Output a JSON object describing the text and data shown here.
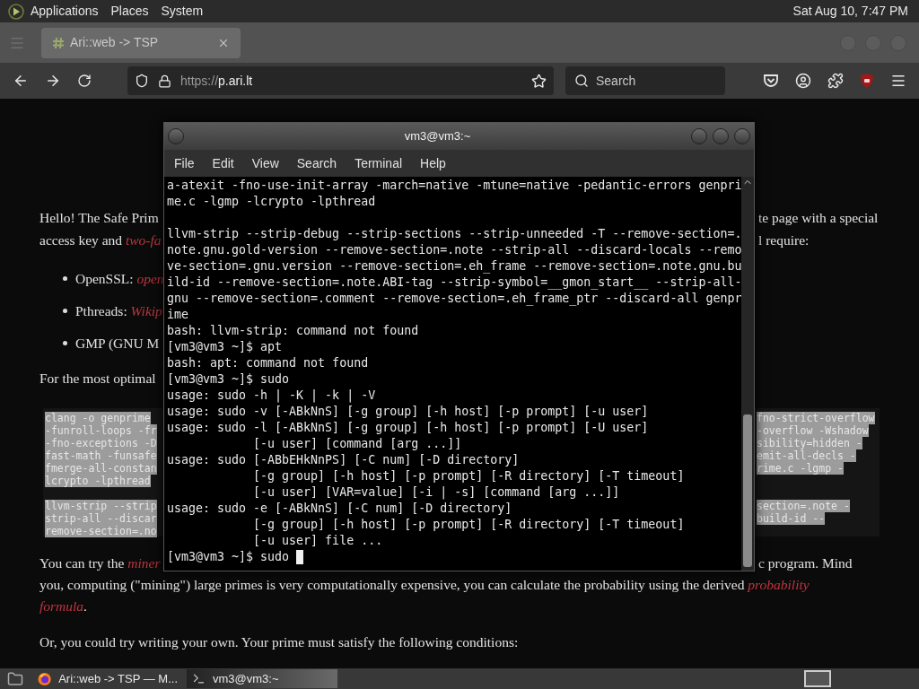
{
  "top_panel": {
    "menus": [
      "Applications",
      "Places",
      "System"
    ],
    "clock": "Sat Aug 10, 7:47 PM"
  },
  "browser": {
    "tabs": [
      {
        "title": "Ari::web -> TSP",
        "selected": true
      }
    ],
    "url": {
      "scheme": "https://",
      "host": "p.ari.lt"
    },
    "search": {
      "placeholder": "Search"
    }
  },
  "page": {
    "intro": [
      {
        "left": "Hello! The Safe Prim",
        "right": "te page with a special"
      },
      {
        "left": "access key and ",
        "link": "two-fa",
        "right": "l require:"
      }
    ],
    "bullets": [
      {
        "left": "OpenSSL: ",
        "link": "open"
      },
      {
        "left": "Pthreads: ",
        "link": "Wikip"
      },
      {
        "left": "GMP (GNU M"
      }
    ],
    "optimal": {
      "left": "For the most optimal"
    },
    "code": {
      "groups": [
        {
          "left": [
            "clang -o genprime",
            "-funroll-loops -fr",
            "-fno-exceptions -D",
            "fast-math -funsafe",
            "fmerge-all-constan",
            "lcrypto -lpthread"
          ],
          "right": [
            "fno-strict-overflow",
            "-overflow -Wshadow",
            "sibility=hidden -",
            "emit-all-decls -",
            "rime.c -lgmp -"
          ]
        },
        {
          "left": [
            "llvm-strip --strip",
            "strip-all --discar",
            "remove-section=.no"
          ],
          "right": [
            "section=.note -",
            "build-id --"
          ]
        }
      ]
    },
    "mining": [
      {
        "kind": "split",
        "left": "You can try the ",
        "link": "miner",
        "right": "c program. Mind"
      },
      {
        "kind": "full",
        "text": "you, computing (\"mining\") large primes is very computationally expensive, you can calculate the probability using the derived ",
        "link": "probability"
      },
      {
        "kind": "full",
        "link": "formula",
        "after": "."
      }
    ],
    "outro": "Or, you could try writing your own. Your prime must satisfy the following conditions:"
  },
  "terminal": {
    "title": "vm3@vm3:~",
    "menus": [
      "File",
      "Edit",
      "View",
      "Search",
      "Terminal",
      "Help"
    ],
    "blocks": [
      [
        "a-atexit -fno-use-init-array -march=native -mtune=native -pedantic-errors genpri",
        "me.c -lgmp -lcrypto -lpthread"
      ],
      [
        "llvm-strip --strip-debug --strip-sections --strip-unneeded -T --remove-section=.",
        "note.gnu.gold-version --remove-section=.note --strip-all --discard-locals --remo",
        "ve-section=.gnu.version --remove-section=.eh_frame --remove-section=.note.gnu.bu",
        "ild-id --remove-section=.note.ABI-tag --strip-symbol=__gmon_start__ --strip-all-",
        "gnu --remove-section=.comment --remove-section=.eh_frame_ptr --discard-all genpr",
        "ime",
        "bash: llvm-strip: command not found",
        "[vm3@vm3 ~]$ apt",
        "bash: apt: command not found",
        "[vm3@vm3 ~]$ sudo",
        "usage: sudo -h | -K | -k | -V",
        "usage: sudo -v [-ABkNnS] [-g group] [-h host] [-p prompt] [-u user]",
        "usage: sudo -l [-ABkNnS] [-g group] [-h host] [-p prompt] [-U user]",
        "            [-u user] [command [arg ...]]",
        "usage: sudo [-ABbEHkNnPS] [-C num] [-D directory]",
        "            [-g group] [-h host] [-p prompt] [-R directory] [-T timeout]",
        "            [-u user] [VAR=value] [-i | -s] [command [arg ...]]",
        "usage: sudo -e [-ABkNnS] [-C num] [-D directory]",
        "            [-g group] [-h host] [-p prompt] [-R directory] [-T timeout]",
        "            [-u user] file ..."
      ]
    ],
    "prompt": "[vm3@vm3 ~]$ sudo ",
    "cursor": true
  },
  "taskbar": {
    "items": [
      {
        "kind": "browser",
        "title": "Ari::web -> TSP — M...",
        "selected": false
      },
      {
        "kind": "terminal",
        "title": "vm3@vm3:~",
        "selected": true
      }
    ]
  }
}
